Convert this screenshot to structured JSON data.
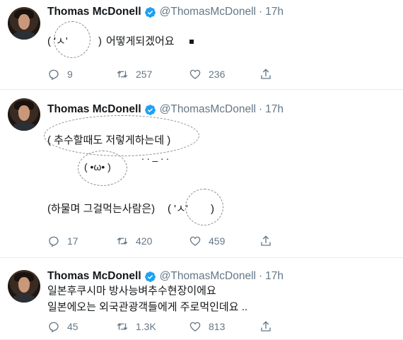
{
  "tweets": [
    {
      "name": "Thomas McDonell",
      "handle": "@ThomasMcDonell",
      "time": "17h",
      "text_prefix": "( 'ㅅ'",
      "text_close": ")",
      "text_main": "어떻게되겠어요",
      "replies": "9",
      "retweets": "257",
      "likes": "236"
    },
    {
      "name": "Thomas McDonell",
      "handle": "@ThomasMcDonell",
      "time": "17h",
      "line1": "( 추수할때도 저렇게하는데 )",
      "face": "( •ω• )",
      "dots": ". . _ . .",
      "line2": "(하물며 그걸먹는사람은)",
      "line2_face": "( 'ㅅ'",
      "line2_close": ")",
      "replies": "17",
      "retweets": "420",
      "likes": "459"
    },
    {
      "name": "Thomas McDonell",
      "handle": "@ThomasMcDonell",
      "time": "17h",
      "line1": "일본후쿠시마 방사능벼추수현장이에요",
      "line2": "일본에오는 외국관광객들에게 주로먹인데요 ..",
      "replies": "45",
      "retweets": "1.3K",
      "likes": "813"
    }
  ],
  "colors": {
    "verified": "#1da1f2",
    "muted": "#657786",
    "text": "#14171a"
  },
  "icons": {
    "reply": "reply-icon",
    "retweet": "retweet-icon",
    "like": "heart-icon",
    "share": "share-icon",
    "verified": "verified-badge-icon"
  }
}
